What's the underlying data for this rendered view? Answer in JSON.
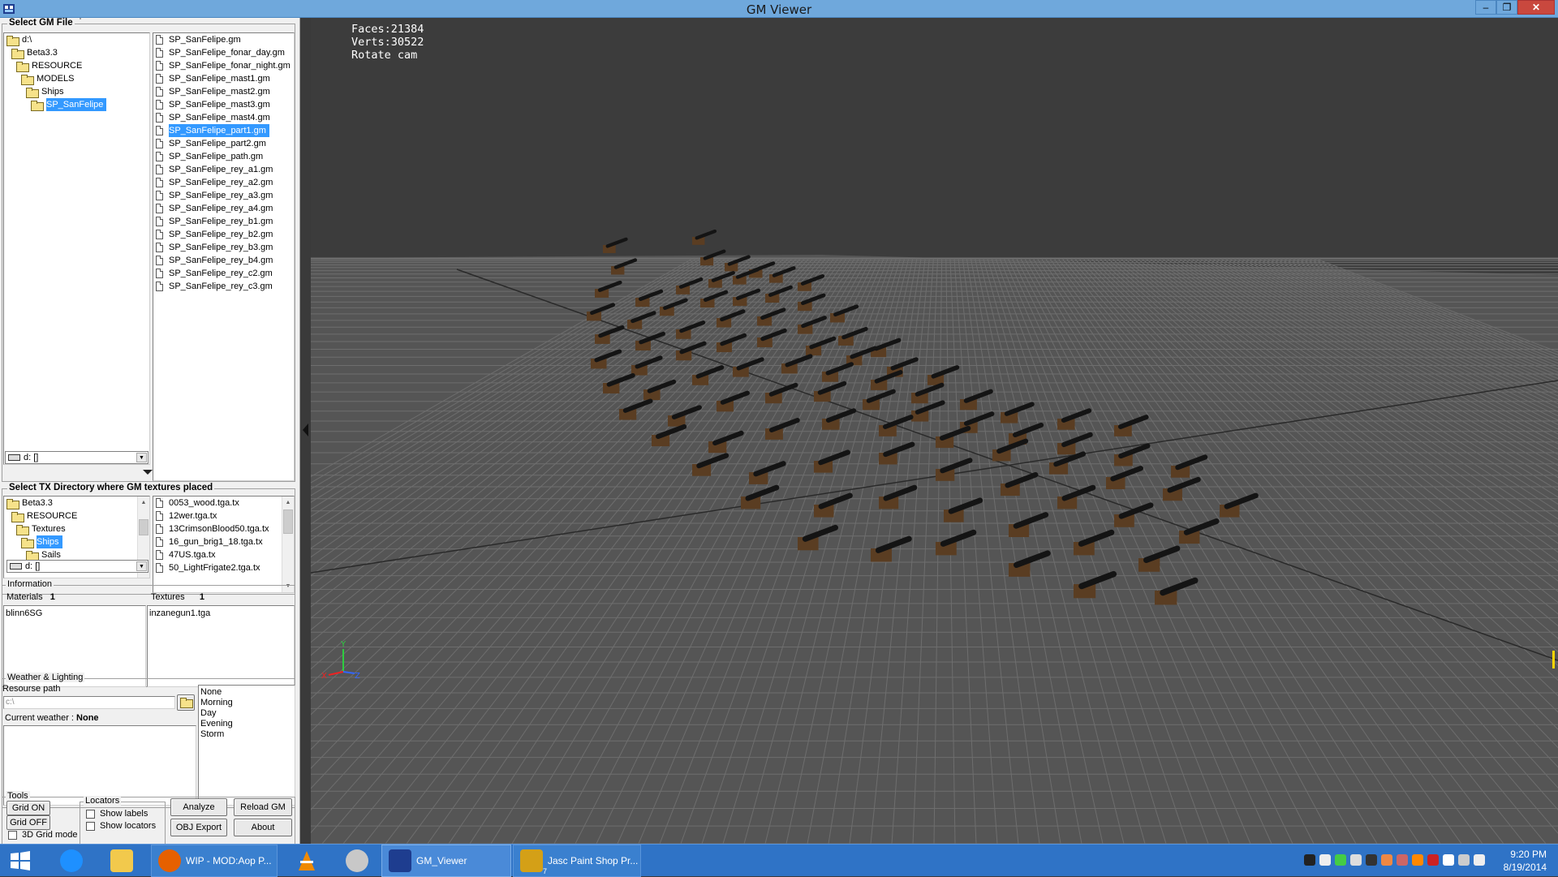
{
  "window": {
    "title": "GM Viewer",
    "minimize": "–",
    "maximize": "❐",
    "close": "✕"
  },
  "gm_file": {
    "group_label": "Select GM File",
    "tree": [
      {
        "label": "d:\\",
        "indent": 0
      },
      {
        "label": "Beta3.3",
        "indent": 1
      },
      {
        "label": "RESOURCE",
        "indent": 2
      },
      {
        "label": "MODELS",
        "indent": 3
      },
      {
        "label": "Ships",
        "indent": 4
      },
      {
        "label": "SP_SanFelipe",
        "indent": 5,
        "selected": true
      }
    ],
    "drive": "d: []",
    "files": [
      {
        "name": "SP_SanFelipe.gm"
      },
      {
        "name": "SP_SanFelipe_fonar_day.gm"
      },
      {
        "name": "SP_SanFelipe_fonar_night.gm"
      },
      {
        "name": "SP_SanFelipe_mast1.gm"
      },
      {
        "name": "SP_SanFelipe_mast2.gm"
      },
      {
        "name": "SP_SanFelipe_mast3.gm"
      },
      {
        "name": "SP_SanFelipe_mast4.gm"
      },
      {
        "name": "SP_SanFelipe_part1.gm",
        "selected": true
      },
      {
        "name": "SP_SanFelipe_part2.gm"
      },
      {
        "name": "SP_SanFelipe_path.gm"
      },
      {
        "name": "SP_SanFelipe_rey_a1.gm"
      },
      {
        "name": "SP_SanFelipe_rey_a2.gm"
      },
      {
        "name": "SP_SanFelipe_rey_a3.gm"
      },
      {
        "name": "SP_SanFelipe_rey_a4.gm"
      },
      {
        "name": "SP_SanFelipe_rey_b1.gm"
      },
      {
        "name": "SP_SanFelipe_rey_b2.gm"
      },
      {
        "name": "SP_SanFelipe_rey_b3.gm"
      },
      {
        "name": "SP_SanFelipe_rey_b4.gm"
      },
      {
        "name": "SP_SanFelipe_rey_c2.gm"
      },
      {
        "name": "SP_SanFelipe_rey_c3.gm"
      }
    ]
  },
  "tx_dir": {
    "group_label": "Select TX Directory where GM textures placed",
    "tree": [
      {
        "label": "Beta3.3",
        "indent": 0
      },
      {
        "label": "RESOURCE",
        "indent": 1
      },
      {
        "label": "Textures",
        "indent": 2
      },
      {
        "label": "Ships",
        "indent": 3,
        "selected": true
      },
      {
        "label": "Sails",
        "indent": 4
      }
    ],
    "drive": "d: []",
    "files": [
      {
        "name": "0053_wood.tga.tx"
      },
      {
        "name": "12wer.tga.tx"
      },
      {
        "name": "13CrimsonBlood50.tga.tx"
      },
      {
        "name": "16_gun_brig1_18.tga.tx"
      },
      {
        "name": "47US.tga.tx"
      },
      {
        "name": "50_LightFrigate2.tga.tx"
      }
    ]
  },
  "information": {
    "group_label": "Information",
    "materials_label": "Materials",
    "materials_count": "1",
    "textures_label": "Textures",
    "textures_count": "1",
    "material_item": "blinn6SG",
    "texture_item": "inzanegun1.tga"
  },
  "weather": {
    "group_label": "Weather & Lighting",
    "resource_path_label": "Resourse path",
    "resource_path_value": "c:\\",
    "current_weather_label": "Current weather :",
    "current_weather_value": "None",
    "options": [
      "None",
      "Morning",
      "Day",
      "Evening",
      "Storm"
    ]
  },
  "tools": {
    "group_label": "Tools",
    "grid_on": "Grid ON",
    "grid_off": "Grid OFF",
    "grid_3d": "3D Grid mode",
    "locators_label": "Locators",
    "show_labels": "Show labels",
    "show_locators": "Show locators",
    "analyze": "Analyze",
    "reload_gm": "Reload GM",
    "obj_export": "OBJ Export",
    "about": "About"
  },
  "viewport": {
    "hud": [
      "Faces:21384",
      "Verts:30522",
      "Rotate cam"
    ],
    "axis_labels": {
      "x": "X",
      "y": "Y",
      "z": "Z"
    }
  },
  "taskbar": {
    "tasks": [
      {
        "label": "WIP - MOD:Aop P...",
        "icon": "firefox-icon"
      },
      {
        "label": "GM_Viewer",
        "icon": "gmviewer-icon",
        "active": true
      },
      {
        "label": "Jasc Paint Shop Pr...",
        "icon": "paintshop-icon",
        "badge": "7"
      }
    ],
    "time": "9:20 PM",
    "date": "8/19/2014"
  },
  "colors": {
    "selection": "#3399ff",
    "titlebar": "#6fa8dc",
    "taskbar": "#2f73c6",
    "viewport_bg": "#3c3c3c"
  }
}
